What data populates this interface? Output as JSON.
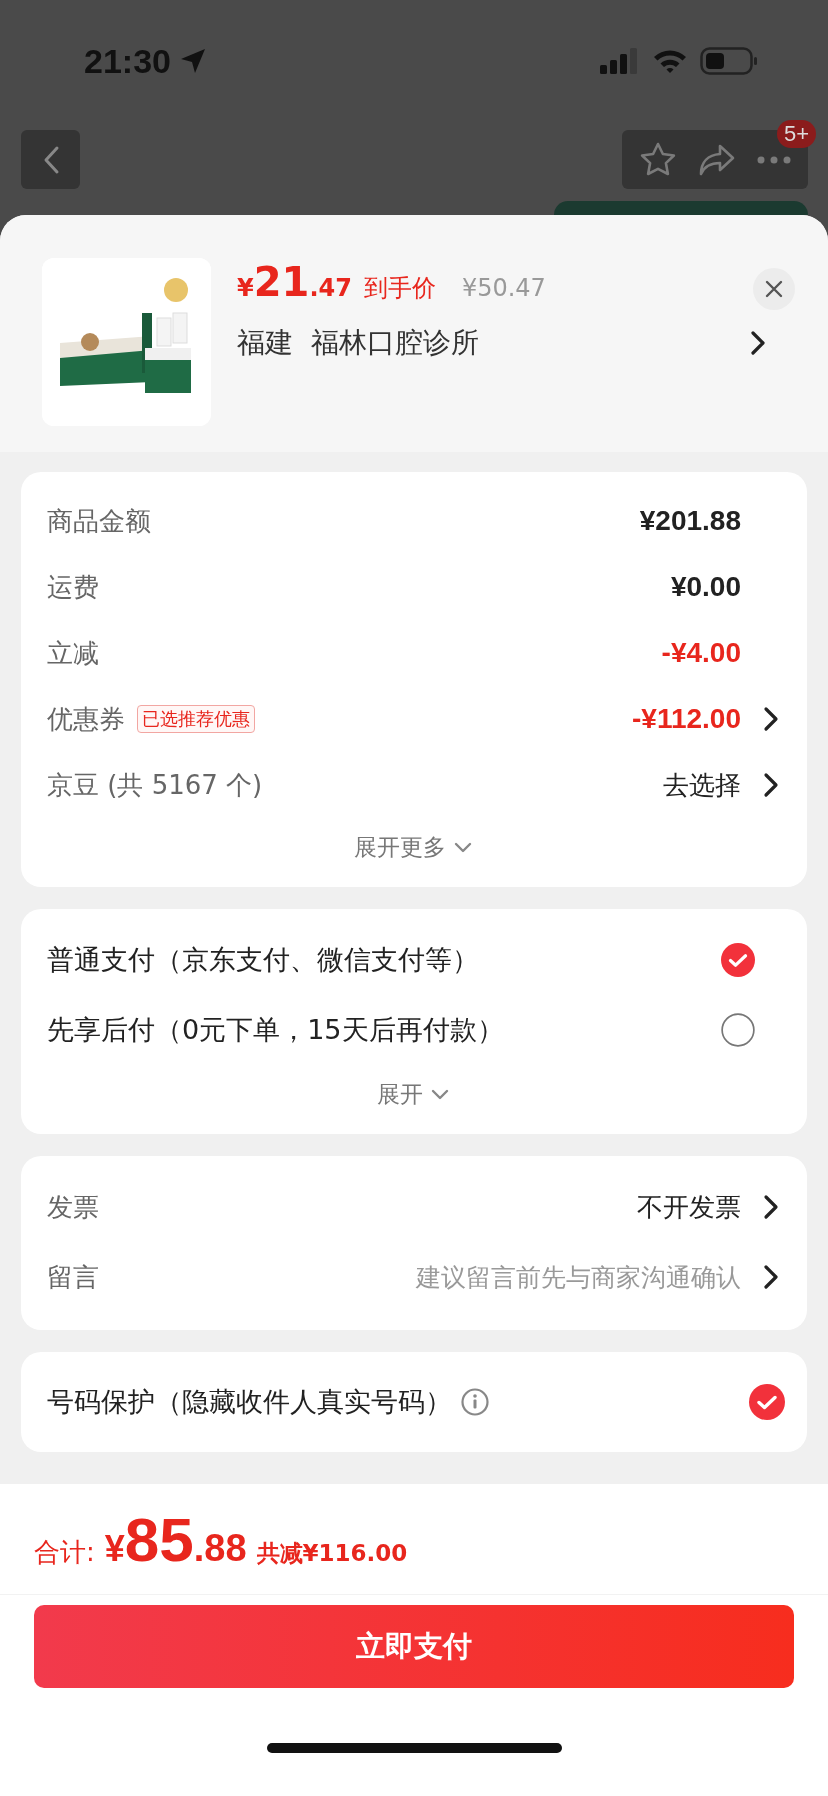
{
  "status_bar": {
    "time": "21:30"
  },
  "nav": {
    "badge": "5+"
  },
  "product": {
    "price_symbol": "¥",
    "price_int": "21",
    "price_dec": ".47",
    "price_label": "到手价",
    "original_price": "¥50.47",
    "store_region": "福建",
    "store_name": "福林口腔诊所"
  },
  "amounts": {
    "rows": [
      {
        "label": "商品金额",
        "value": "¥201.88",
        "discount": false,
        "arrow": false
      },
      {
        "label": "运费",
        "value": "¥0.00",
        "discount": false,
        "arrow": false
      },
      {
        "label": "立减",
        "value": "-¥4.00",
        "discount": true,
        "arrow": false
      },
      {
        "label": "优惠券",
        "tag": "已选推荐优惠",
        "value": "-¥112.00",
        "discount": true,
        "arrow": true
      },
      {
        "label": "京豆 (共 5167 个)",
        "value": "去选择",
        "discount": false,
        "arrow": true
      }
    ],
    "expand": "展开更多"
  },
  "payment": {
    "options": [
      {
        "label": "普通支付（京东支付、微信支付等）",
        "selected": true
      },
      {
        "label": "先享后付（0元下单，15天后再付款）",
        "selected": false
      }
    ],
    "expand": "展开"
  },
  "extras": {
    "rows": [
      {
        "label": "发票",
        "value": "不开发票"
      },
      {
        "label": "留言",
        "placeholder": "建议留言前先与商家沟通确认"
      }
    ]
  },
  "privacy": {
    "label": "号码保护（隐藏收件人真实号码）",
    "checked": true
  },
  "footer": {
    "total_label": "合计:",
    "total_symbol": "¥",
    "total_int": "85",
    "total_dec": ".88",
    "saving": "共减¥116.00",
    "pay_button": "立即支付"
  }
}
